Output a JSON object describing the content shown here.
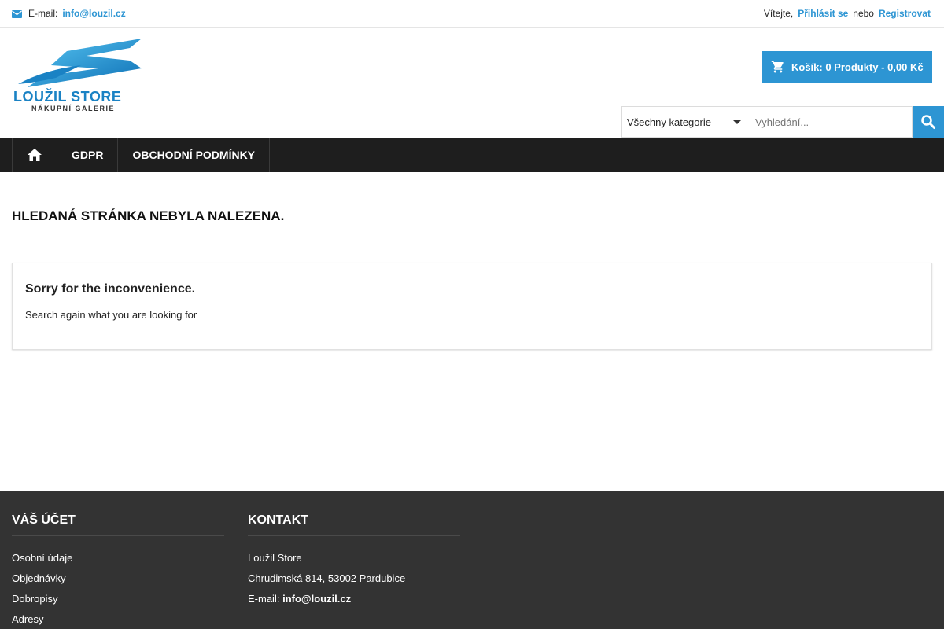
{
  "topbar": {
    "email_label": "E-mail:",
    "email": "info@louzil.cz",
    "welcome": "Vítejte,",
    "login": "Přihlásit se",
    "or": "nebo",
    "register": "Registrovat"
  },
  "logo": {
    "brand": "LOUŽIL STORE",
    "sub": "NÁKUPNÍ GALERIE"
  },
  "cart": {
    "label": "Košík: 0 Produkty - 0,00 Kč"
  },
  "search": {
    "category": "Všechny kategorie",
    "placeholder": "Vyhledání..."
  },
  "nav": {
    "items": [
      "GDPR",
      "OBCHODNÍ PODMÍNKY"
    ]
  },
  "main": {
    "title": "HLEDANÁ STRÁNKA NEBYLA NALEZENA.",
    "heading": "Sorry for the inconvenience.",
    "text": "Search again what you are looking for"
  },
  "footer": {
    "account": {
      "title": "VÁŠ ÚČET",
      "links": [
        "Osobní údaje",
        "Objednávky",
        "Dobropisy",
        "Adresy"
      ]
    },
    "contact": {
      "title": "KONTAKT",
      "name": "Loužil Store",
      "address": "Chrudimská 814, 53002 Pardubice",
      "email_label": "E-mail:",
      "email": "info@louzil.cz"
    }
  },
  "colors": {
    "accent": "#2d95d3",
    "nav_bg": "#1e1e1e",
    "footer_bg": "#333333"
  },
  "icons": {
    "email": "envelope-icon",
    "cart": "cart-icon",
    "home": "home-icon",
    "search": "search-icon",
    "caret": "caret-down-icon"
  }
}
